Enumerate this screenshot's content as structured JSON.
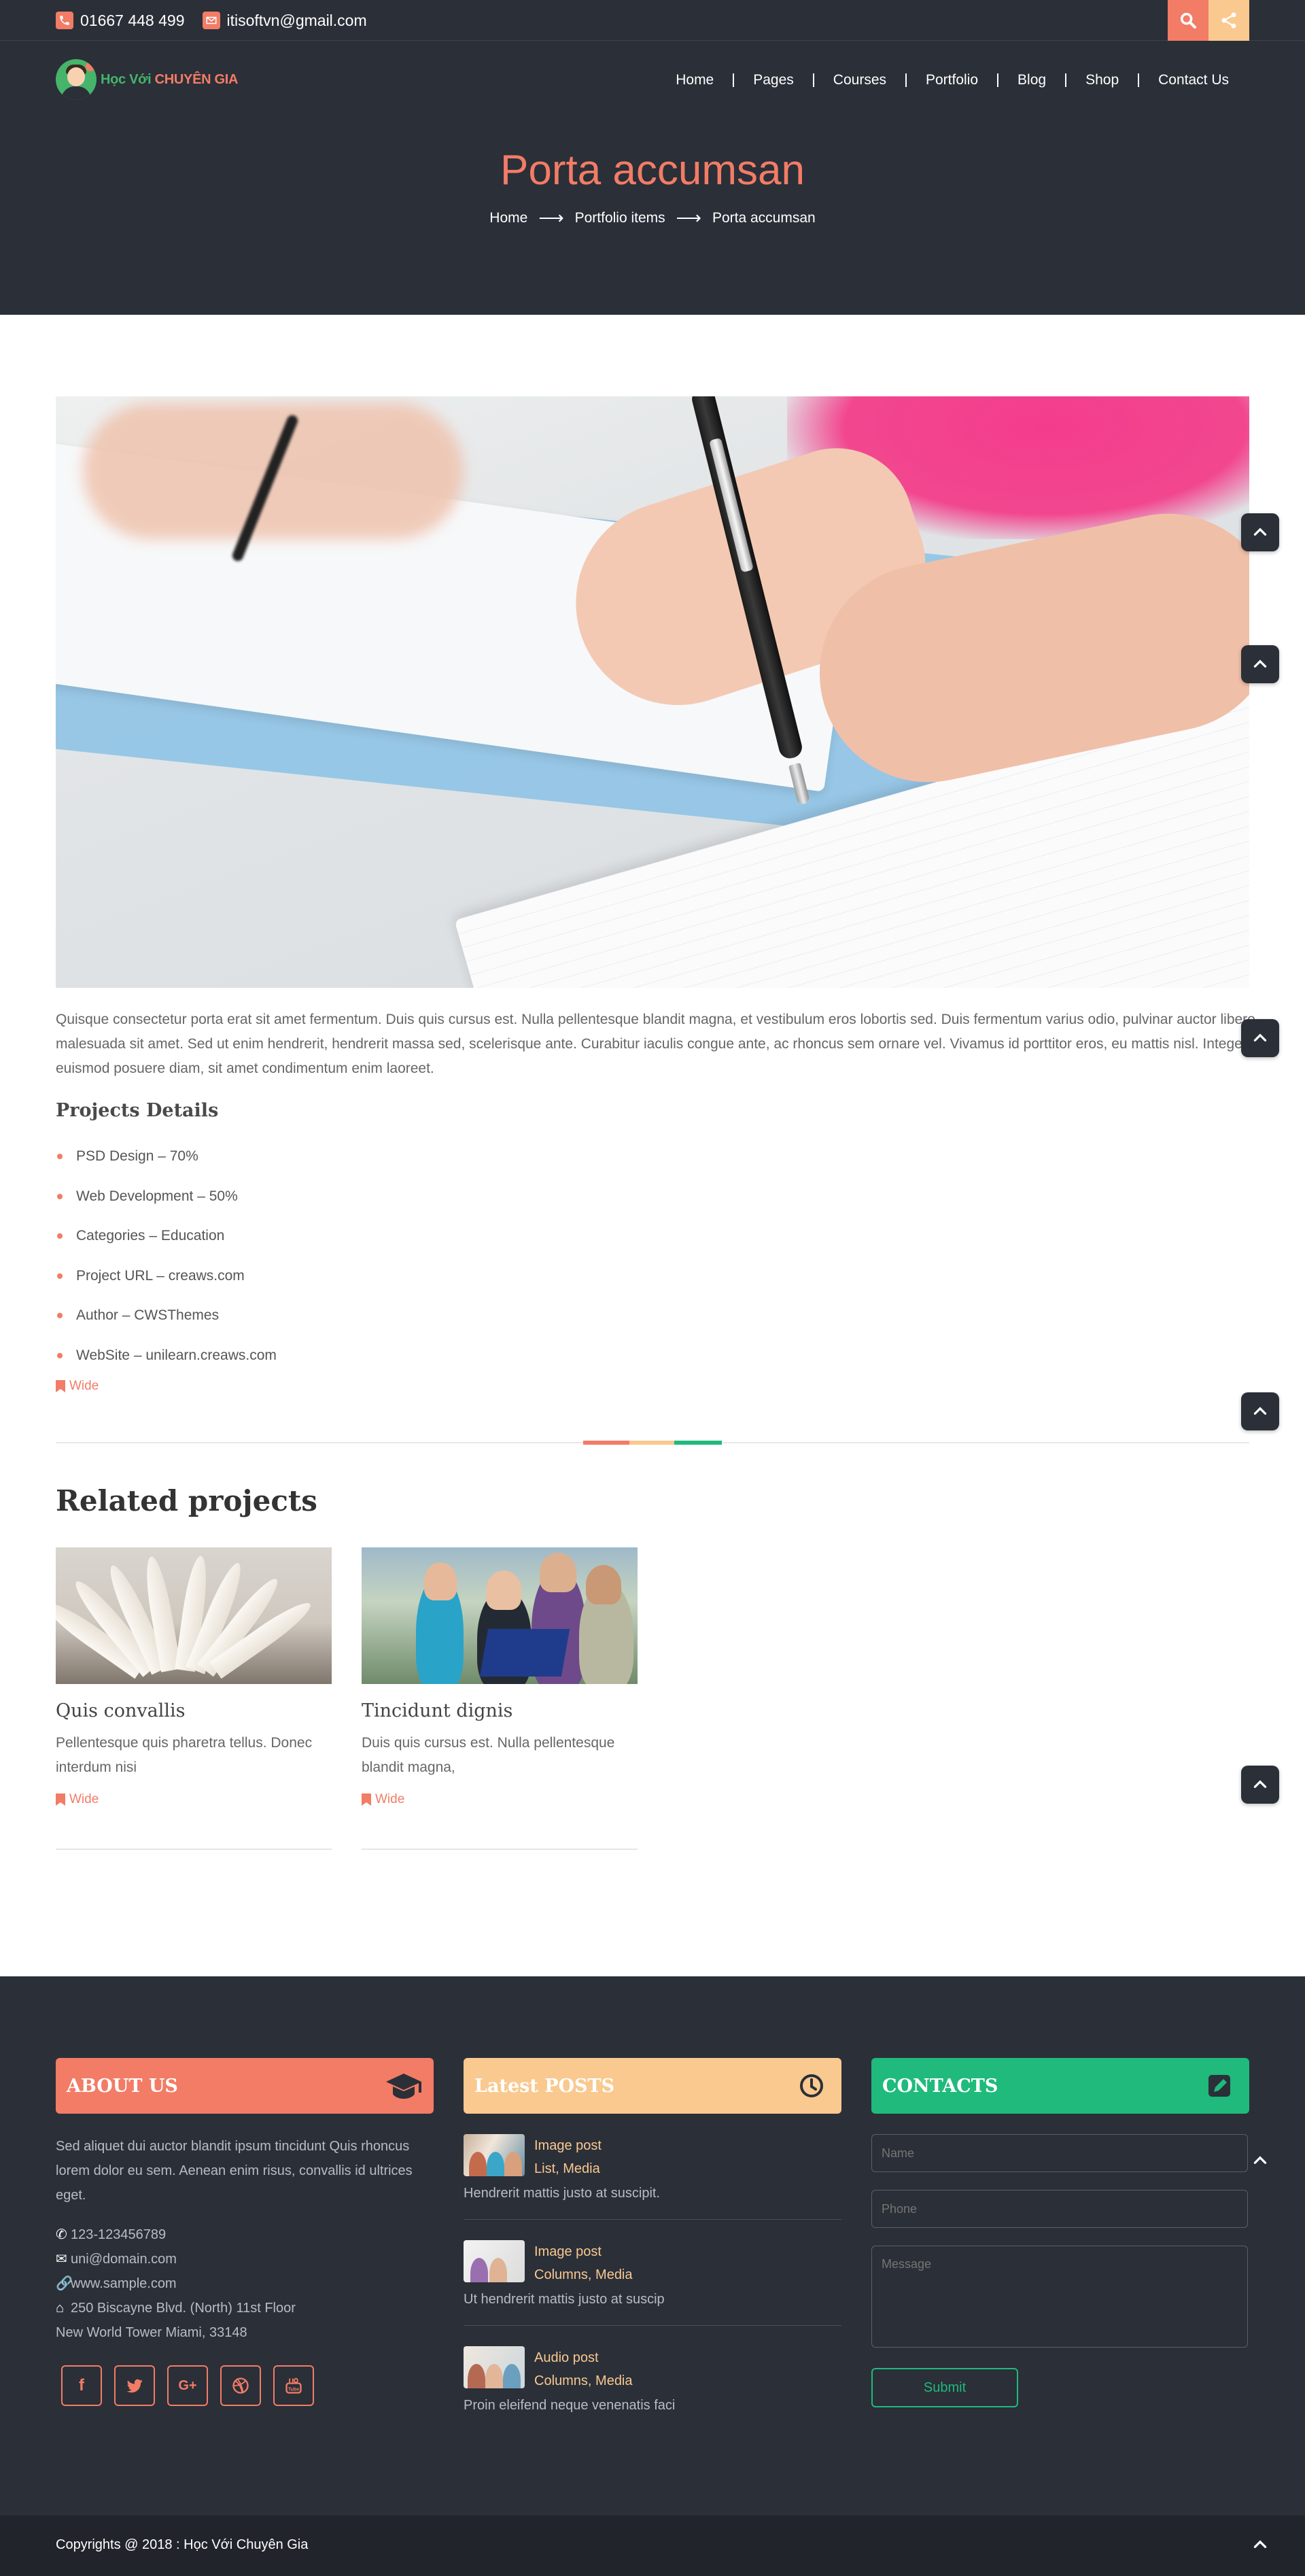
{
  "topbar": {
    "phone": "01667 448 499",
    "email": "itisoftvn@gmail.com",
    "icons": [
      "phone-icon",
      "mail-icon",
      "search-icon",
      "share-icon"
    ]
  },
  "logo": {
    "part1": "Học Với",
    "part2": "Chuyên Gia"
  },
  "nav": {
    "items": [
      "Home",
      "Pages",
      "Courses",
      "Portfolio",
      "Blog",
      "Shop",
      "Contact Us"
    ]
  },
  "hero": {
    "title": "Porta accumsan",
    "breadcrumbs": [
      "Home",
      "Portfolio items",
      "Porta accumsan"
    ],
    "arrow": "⟶"
  },
  "main": {
    "description": "Quisque consectetur porta erat sit amet fermentum. Duis quis cursus est. Nulla pellentesque blandit magna, et vestibulum eros lobortis sed. Duis fermentum varius odio, pulvinar auctor libero malesuada sit amet. Sed ut enim hendrerit, hendrerit massa sed, scelerisque ante. Curabitur iaculis congue ante, ac rhoncus sem ornare vel. Vivamus id porttitor eros, eu mattis nisl. Integer euismod posuere diam, sit amet condimentum enim laoreet.",
    "details_title": "Projects Details",
    "details": [
      "PSD Design – 70%",
      "Web Development – 50%",
      "Categories – Education",
      "Project URL – creaws.com",
      "Author – CWSThemes",
      "WebSite – unilearn.creaws.com"
    ],
    "tag": "Wide"
  },
  "divider_colors": [
    "#f27c66",
    "#f9c98f",
    "#1fba7c"
  ],
  "related": {
    "title": "Related projects",
    "cards": [
      {
        "title": "Quis convallis",
        "text": "Pellentesque quis pharetra tellus. Donec interdum nisi",
        "tag": "Wide"
      },
      {
        "title": "Tincidunt dignis",
        "text": "Duis quis cursus est. Nulla pellentesque blandit magna,",
        "tag": "Wide"
      }
    ]
  },
  "footer": {
    "about": {
      "title": "ABOUT US",
      "text": "Sed aliquet dui auctor blandit ipsum tincidunt Quis rhoncus lorem dolor eu sem. Aenean enim risus, convallis id ultrices eget.",
      "phone": "123-123456789",
      "email": "uni@domain.com",
      "website": "www.sample.com",
      "address1": "250 Biscayne Blvd. (North) 11st Floor",
      "address2": "New World Tower Miami, 33148",
      "color": "#f27c66"
    },
    "latest": {
      "title": "Latest POSTS",
      "color": "#f9c98f",
      "posts": [
        {
          "title": "Image post",
          "cats": "List, Media",
          "excerpt": "Hendrerit mattis justo at suscipit."
        },
        {
          "title": "Image post",
          "cats": "Columns, Media",
          "excerpt": "Ut hendrerit mattis justo at suscip"
        },
        {
          "title": "Audio post",
          "cats": "Columns, Media",
          "excerpt": "Proin eleifend neque venenatis faci"
        }
      ]
    },
    "contacts": {
      "title": "CONTACTS",
      "color": "#1fba7c",
      "name_placeholder": "Name",
      "phone_placeholder": "Phone",
      "message_placeholder": "Message",
      "submit": "Submit"
    },
    "socials": [
      "facebook-icon",
      "twitter-icon",
      "google-plus-icon",
      "dribbble-icon",
      "youtube-icon"
    ]
  },
  "copyright": "Copyrights @ 2018 : Học Với Chuyên Gia"
}
